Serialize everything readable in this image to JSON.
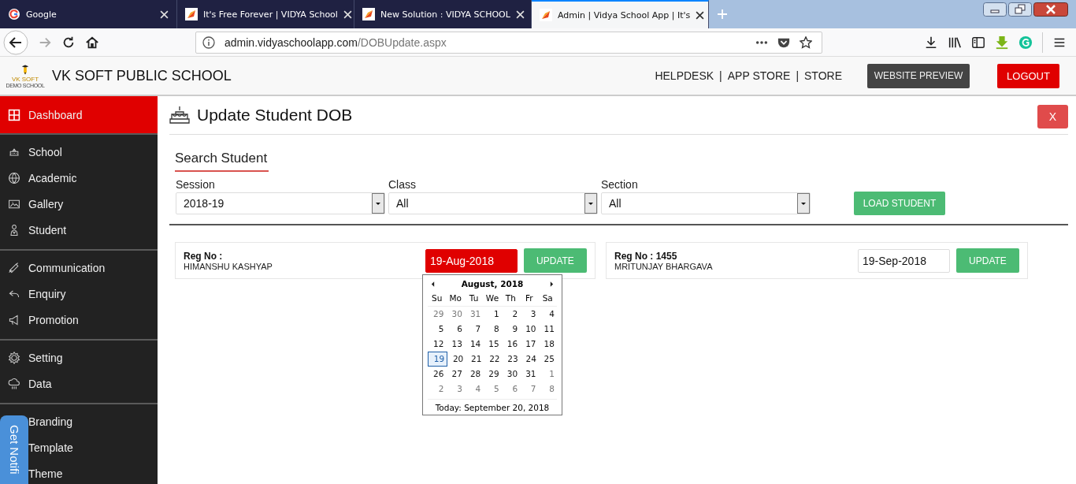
{
  "browser": {
    "tabs": [
      {
        "title": "Google",
        "selected": false
      },
      {
        "title": "It's Free Forever | VIDYA School",
        "selected": false
      },
      {
        "title": "New Solution : VIDYA SCHOOL",
        "selected": false
      },
      {
        "title": "Admin | Vidya School App | It's",
        "selected": true
      }
    ],
    "url_host": "admin.vidyaschoolapp.com",
    "url_path": "/DOBUpdate.aspx"
  },
  "header": {
    "logo_line1": "VK SOFT",
    "logo_line2": "DEMO SCHOOL",
    "school_name": "VK SOFT PUBLIC SCHOOL",
    "nav": [
      {
        "kind": "link",
        "text": "HELPDESK"
      },
      {
        "kind": "separator",
        "text": "|"
      },
      {
        "kind": "link",
        "text": "APP STORE"
      },
      {
        "kind": "separator",
        "text": "|"
      },
      {
        "kind": "link",
        "text": "STORE"
      }
    ],
    "preview_button": "WEBSITE PREVIEW",
    "logout_button": "LOGOUT"
  },
  "sidebar": {
    "top_item": {
      "label": "Dashboard",
      "selected": true
    },
    "groups": [
      [
        {
          "label": "School",
          "selected": false
        },
        {
          "label": "Academic",
          "selected": false
        },
        {
          "label": "Gallery",
          "selected": false
        },
        {
          "label": "Student",
          "selected": false
        }
      ],
      [
        {
          "label": "Communication",
          "selected": false
        },
        {
          "label": "Enquiry",
          "selected": false
        },
        {
          "label": "Promotion",
          "selected": false
        }
      ],
      [
        {
          "label": "Setting",
          "selected": false
        },
        {
          "label": "Data",
          "selected": false
        }
      ],
      [
        {
          "label": "Branding",
          "selected": false
        },
        {
          "label": "Template",
          "selected": false
        },
        {
          "label": "Theme",
          "selected": false
        }
      ]
    ]
  },
  "notify_tab": "Get Notifi",
  "page": {
    "title": "Update Student DOB",
    "close_button": "X",
    "section_title": "Search Student",
    "filters": [
      {
        "label": "Session",
        "value": "2018-19"
      },
      {
        "label": "Class",
        "value": "All"
      },
      {
        "label": "Section",
        "value": "All"
      }
    ],
    "load_button": "LOAD STUDENT",
    "students": [
      {
        "reg": "Reg No :",
        "name": "HIMANSHU KASHYAP",
        "dob": "19-Aug-2018",
        "highlighted": true,
        "button": "UPDATE"
      },
      {
        "reg": "Reg No : 1455",
        "name": "MRITUNJAY BHARGAVA",
        "dob": "19-Sep-2018",
        "highlighted": false,
        "button": "UPDATE"
      }
    ]
  },
  "calendar": {
    "month": "August, 2018",
    "weekdays": [
      "Su",
      "Mo",
      "Tu",
      "We",
      "Th",
      "Fr",
      "Sa"
    ],
    "weeks": [
      [
        {
          "d": "29",
          "muted": true,
          "selected": false
        },
        {
          "d": "30",
          "muted": true,
          "selected": false
        },
        {
          "d": "31",
          "muted": true,
          "selected": false
        },
        {
          "d": "1",
          "muted": false,
          "selected": false
        },
        {
          "d": "2",
          "muted": false,
          "selected": false
        },
        {
          "d": "3",
          "muted": false,
          "selected": false
        },
        {
          "d": "4",
          "muted": false,
          "selected": false
        }
      ],
      [
        {
          "d": "5",
          "muted": false,
          "selected": false
        },
        {
          "d": "6",
          "muted": false,
          "selected": false
        },
        {
          "d": "7",
          "muted": false,
          "selected": false
        },
        {
          "d": "8",
          "muted": false,
          "selected": false
        },
        {
          "d": "9",
          "muted": false,
          "selected": false
        },
        {
          "d": "10",
          "muted": false,
          "selected": false
        },
        {
          "d": "11",
          "muted": false,
          "selected": false
        }
      ],
      [
        {
          "d": "12",
          "muted": false,
          "selected": false
        },
        {
          "d": "13",
          "muted": false,
          "selected": false
        },
        {
          "d": "14",
          "muted": false,
          "selected": false
        },
        {
          "d": "15",
          "muted": false,
          "selected": false
        },
        {
          "d": "16",
          "muted": false,
          "selected": false
        },
        {
          "d": "17",
          "muted": false,
          "selected": false
        },
        {
          "d": "18",
          "muted": false,
          "selected": false
        }
      ],
      [
        {
          "d": "19",
          "muted": false,
          "selected": true
        },
        {
          "d": "20",
          "muted": false,
          "selected": false
        },
        {
          "d": "21",
          "muted": false,
          "selected": false
        },
        {
          "d": "22",
          "muted": false,
          "selected": false
        },
        {
          "d": "23",
          "muted": false,
          "selected": false
        },
        {
          "d": "24",
          "muted": false,
          "selected": false
        },
        {
          "d": "25",
          "muted": false,
          "selected": false
        }
      ],
      [
        {
          "d": "26",
          "muted": false,
          "selected": false
        },
        {
          "d": "27",
          "muted": false,
          "selected": false
        },
        {
          "d": "28",
          "muted": false,
          "selected": false
        },
        {
          "d": "29",
          "muted": false,
          "selected": false
        },
        {
          "d": "30",
          "muted": false,
          "selected": false
        },
        {
          "d": "31",
          "muted": false,
          "selected": false
        },
        {
          "d": "1",
          "muted": true,
          "selected": false
        }
      ],
      [
        {
          "d": "2",
          "muted": true,
          "selected": false
        },
        {
          "d": "3",
          "muted": true,
          "selected": false
        },
        {
          "d": "4",
          "muted": true,
          "selected": false
        },
        {
          "d": "5",
          "muted": true,
          "selected": false
        },
        {
          "d": "6",
          "muted": true,
          "selected": false
        },
        {
          "d": "7",
          "muted": true,
          "selected": false
        },
        {
          "d": "8",
          "muted": true,
          "selected": false
        }
      ]
    ],
    "today": "Today: September 20, 2018"
  }
}
